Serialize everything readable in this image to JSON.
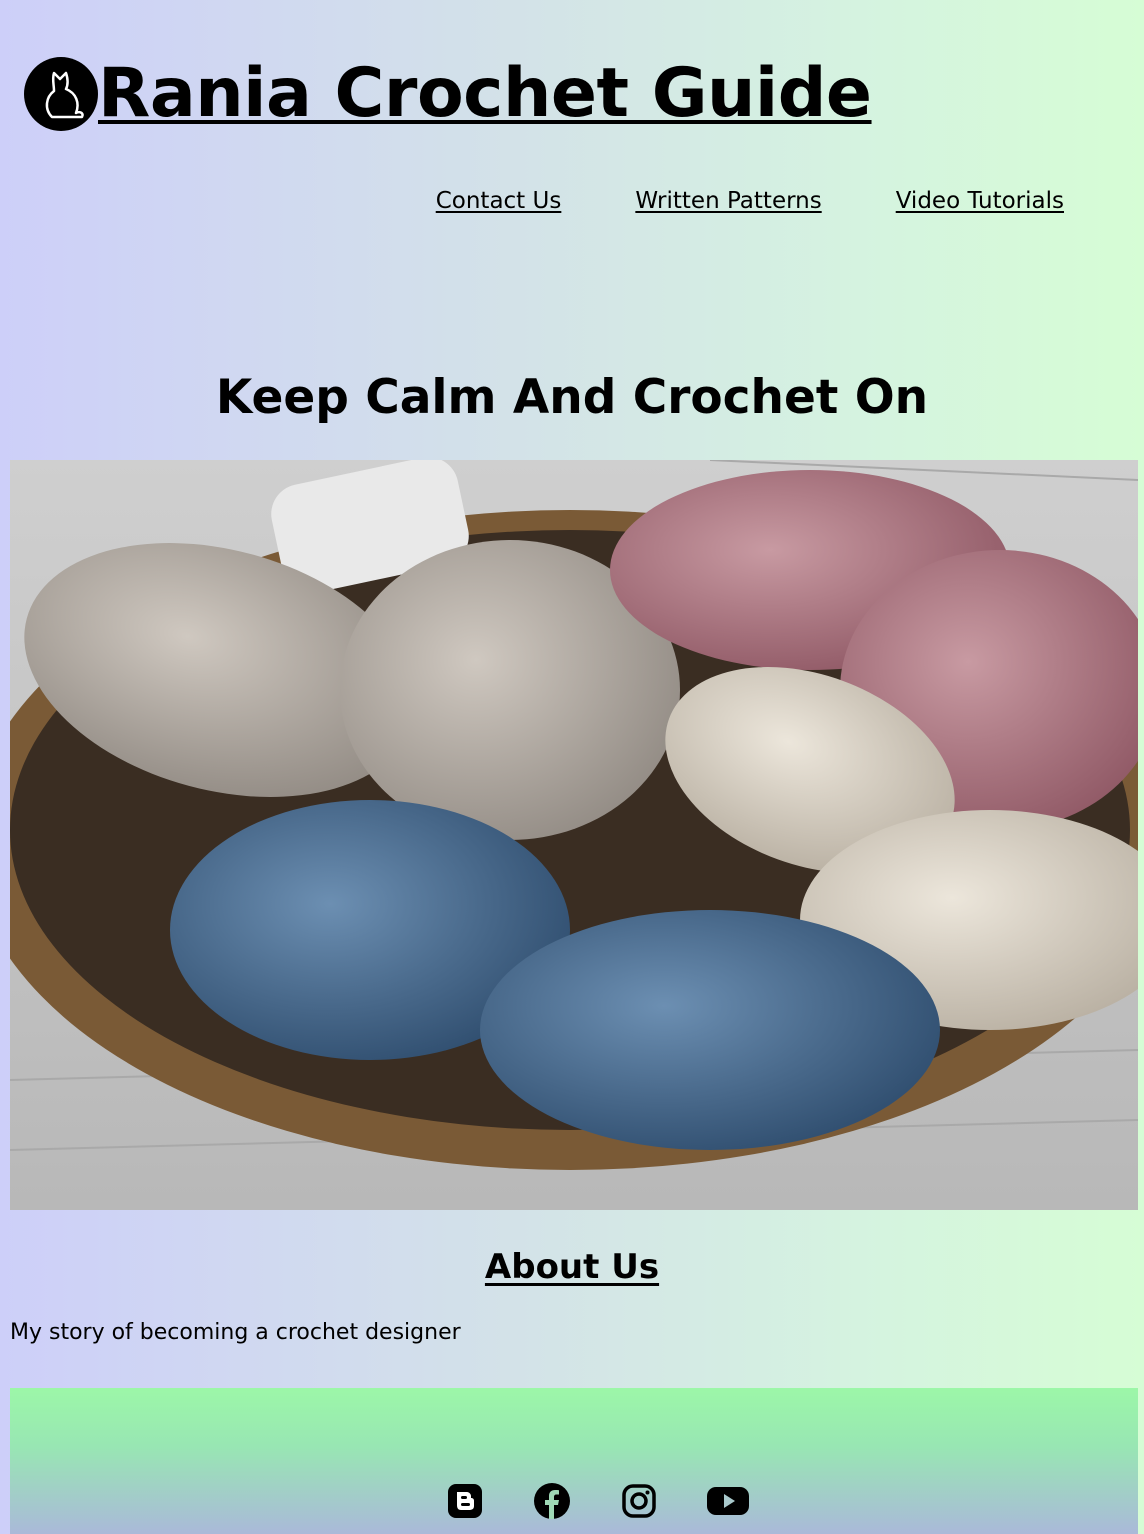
{
  "header": {
    "logo": "cat-silhouette-logo",
    "title": "Rania Crochet Guide"
  },
  "nav": {
    "items": [
      {
        "label": "Contact Us"
      },
      {
        "label": "Written Patterns"
      },
      {
        "label": "Video Tutorials"
      }
    ]
  },
  "hero": {
    "title": "Keep Calm And Crochet On",
    "image": "yarn-skeins-in-basket-photo"
  },
  "about": {
    "title": "About Us",
    "text": "My story of becoming a crochet designer"
  },
  "footer": {
    "social_icons": [
      "blogger-icon",
      "facebook-icon",
      "instagram-icon",
      "youtube-icon"
    ]
  },
  "colors": {
    "background_left": "#cdcff9",
    "background_right": "#d6fdd5",
    "footer_top": "#9cf7a8",
    "footer_bottom": "#aab9d9"
  }
}
